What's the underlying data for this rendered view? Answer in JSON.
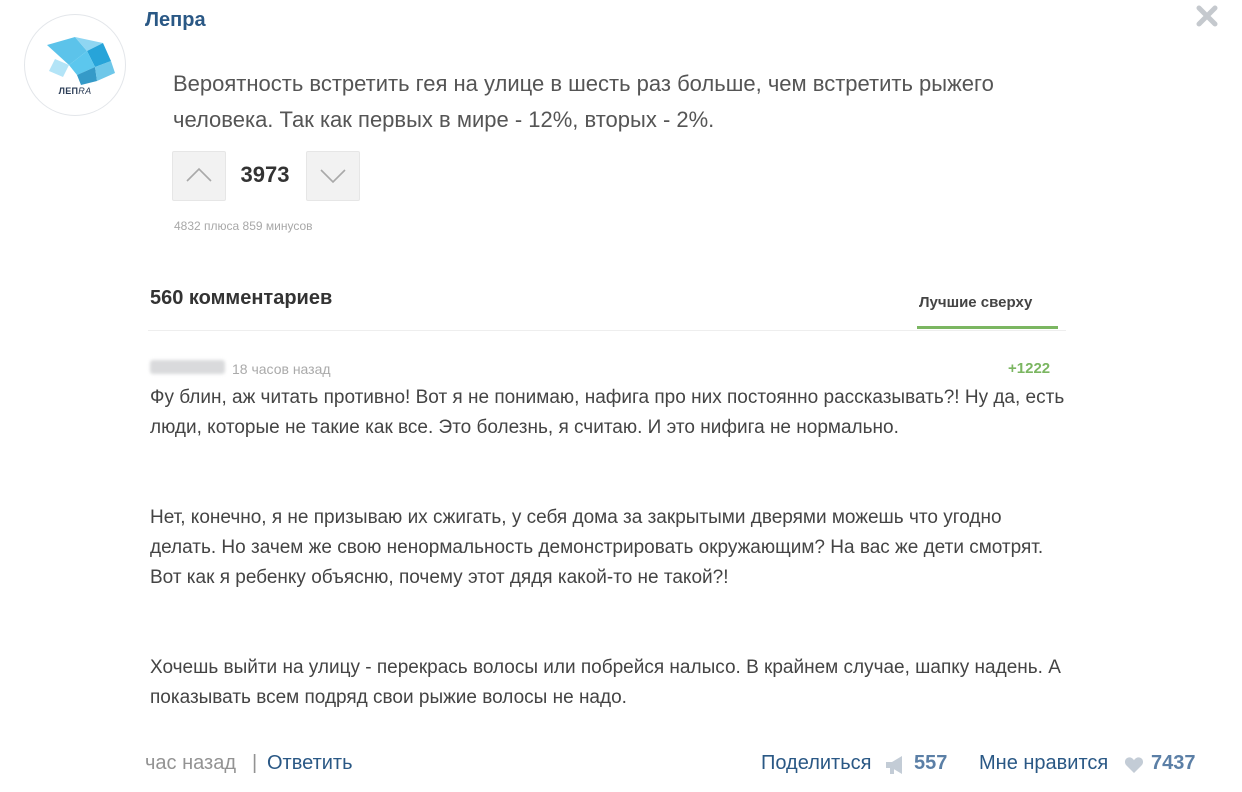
{
  "post": {
    "group_name": "Лепра",
    "avatar_label_main": "ЛЕП",
    "avatar_label_italic": "RA",
    "text": "Вероятность встретить гея на улице в шесть раз больше, чем встретить рыжего человека. Так как первых в мире - 12%, вторых - 2%.",
    "rating": "3973",
    "rating_detail": "4832 плюса 859 минусов"
  },
  "comments_header": {
    "count_label": "560 комментариев",
    "sort_label": "Лучшие сверху"
  },
  "comment": {
    "time": "18 часов назад",
    "rating": "+1222",
    "paragraphs": [
      "Фу блин, аж читать противно! Вот я не понимаю, нафига про них постоянно рассказывать?! Ну да, есть люди, которые не такие как все. Это болезнь, я считаю. И это нифига не нормально.",
      "Нет, конечно, я не призываю их сжигать, у себя дома за закрытыми дверями можешь что угодно делать. Но зачем же свою ненормальность демонстрировать окружающим? На вас же дети смотрят. Вот как я ребенку объясню, почему этот дядя какой-то не такой?!",
      "Хочешь выйти на улицу - перекрась волосы или побрейся налысо. В крайнем случае, шапку надень. А показывать всем подряд свои рыжие волосы не надо."
    ]
  },
  "footer": {
    "time": "час назад",
    "separator": "|",
    "reply_label": "Ответить",
    "share_label": "Поделиться",
    "share_count": "557",
    "like_label": "Мне нравится",
    "like_count": "7437"
  },
  "icons": {
    "close": "close-icon",
    "vote_up": "chevron-up-icon",
    "vote_down": "chevron-down-icon",
    "share": "megaphone-icon",
    "like": "heart-icon"
  },
  "colors": {
    "link": "#2a5885",
    "accent_green": "#7bb661",
    "muted": "#939393"
  }
}
